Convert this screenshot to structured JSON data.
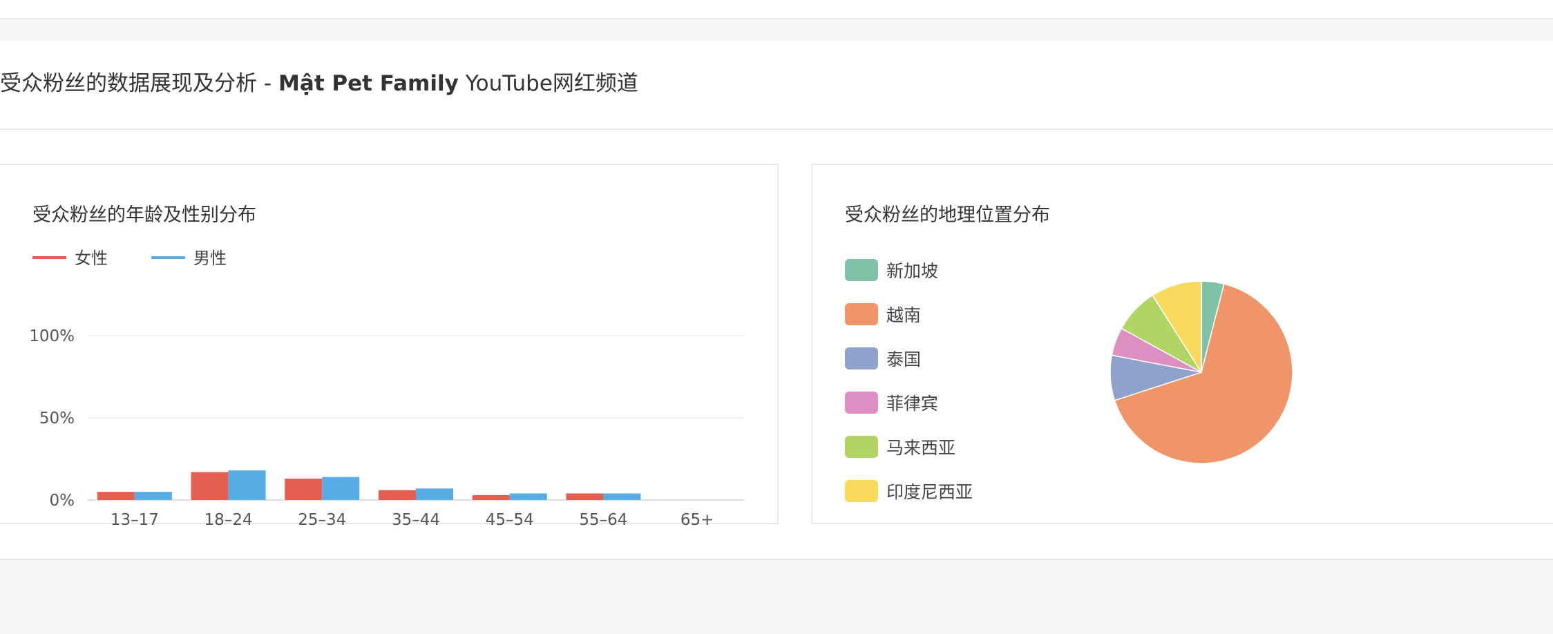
{
  "header": {
    "title_prefix": "受众粉丝的数据展现及分析 -",
    "channel_name": "Mật Pet Family",
    "title_suffix": "YouTube网红频道"
  },
  "chart_data": [
    {
      "type": "bar",
      "title": "受众粉丝的年龄及性别分布",
      "categories": [
        "13–17",
        "18–24",
        "25–34",
        "35–44",
        "45–54",
        "55–64",
        "65+"
      ],
      "series": [
        {
          "name": "女性",
          "color": "#e35f52",
          "values": [
            5,
            17,
            13,
            6,
            3,
            4,
            0
          ]
        },
        {
          "name": "男性",
          "color": "#57aee6",
          "values": [
            5,
            18,
            14,
            7,
            4,
            4,
            0
          ]
        }
      ],
      "yticks": [
        "100%",
        "50%",
        "0%"
      ],
      "ylim": [
        0,
        100
      ],
      "legend": "top-left",
      "grid": true
    },
    {
      "type": "pie",
      "title": "受众粉丝的地理位置分布",
      "labels": [
        "新加坡",
        "越南",
        "泰国",
        "菲律宾",
        "马来西亚",
        "印度尼西亚"
      ],
      "values": [
        4,
        66,
        8,
        5,
        8,
        9
      ],
      "colors": [
        "#80c2a8",
        "#f0956a",
        "#8fa2cb",
        "#de8fc1",
        "#b0d565",
        "#f9d95b"
      ],
      "legend": "left"
    }
  ]
}
